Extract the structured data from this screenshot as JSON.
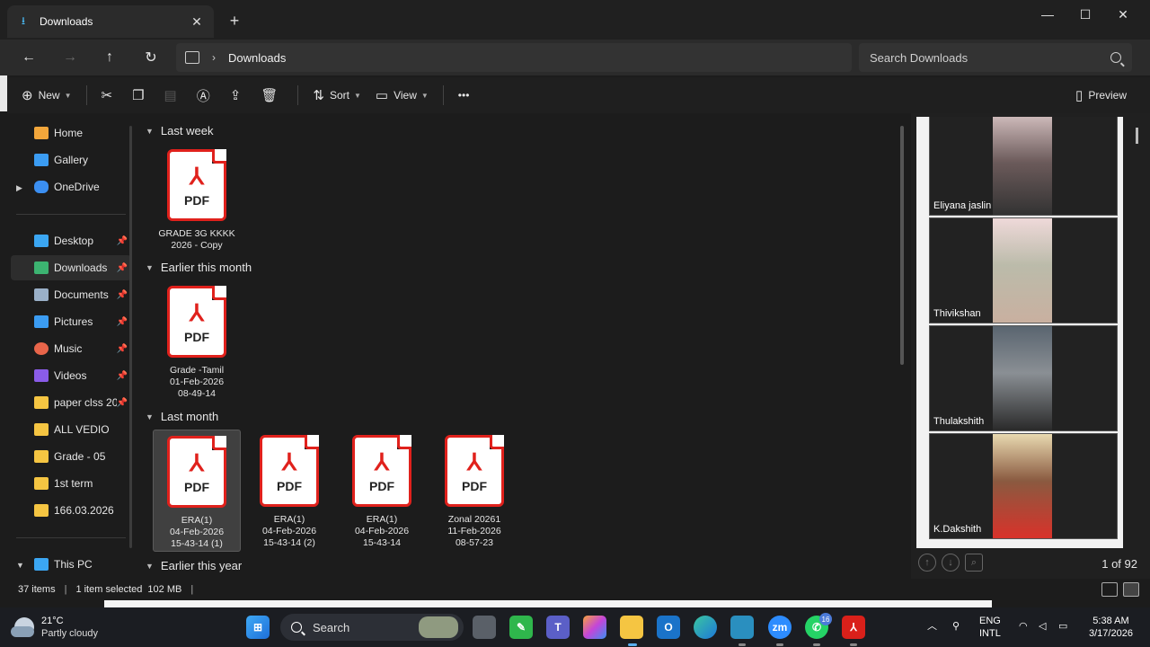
{
  "window": {
    "tab_title": "Downloads",
    "close_tab": "✕",
    "new_tab": "+",
    "minimize": "—",
    "maximize": "☐",
    "close": "✕"
  },
  "address": {
    "crumb": "Downloads",
    "search_placeholder": "Search Downloads"
  },
  "commands": {
    "new_label": "New",
    "sort_label": "Sort",
    "view_label": "View",
    "more": "•••",
    "preview_label": "Preview"
  },
  "sidebar": {
    "items": [
      {
        "label": "Home",
        "icon": "home-icon",
        "color": "#f2a63b"
      },
      {
        "label": "Gallery",
        "icon": "gallery-icon",
        "color": "#3b9cf2"
      },
      {
        "label": "OneDrive",
        "icon": "onedrive-icon",
        "color": "#3b8ff2"
      },
      {
        "label": "Desktop",
        "icon": "desktop-icon",
        "color": "#3ba6f2"
      },
      {
        "label": "Downloads",
        "icon": "downloads-icon",
        "color": "#3cb371"
      },
      {
        "label": "Documents",
        "icon": "documents-icon",
        "color": "#9ab0c8"
      },
      {
        "label": "Pictures",
        "icon": "pictures-icon",
        "color": "#3b9cf2"
      },
      {
        "label": "Music",
        "icon": "music-icon",
        "color": "#e8654a"
      },
      {
        "label": "Videos",
        "icon": "videos-icon",
        "color": "#8a5ce8"
      },
      {
        "label": "paper clss 20",
        "icon": "folder-icon",
        "color": "#f5c542"
      },
      {
        "label": "ALL VEDIO",
        "icon": "folder-icon",
        "color": "#f5c542"
      },
      {
        "label": "Grade - 05",
        "icon": "folder-icon",
        "color": "#f5c542"
      },
      {
        "label": "1st term",
        "icon": "folder-icon",
        "color": "#f5c542"
      },
      {
        "label": "166.03.2026",
        "icon": "folder-icon",
        "color": "#f5c542"
      },
      {
        "label": "This PC",
        "icon": "this-pc-icon",
        "color": "#3ba6f2"
      }
    ]
  },
  "groups": [
    {
      "label": "Last week"
    },
    {
      "label": "Earlier this month"
    },
    {
      "label": "Last month"
    },
    {
      "label": "Earlier this year"
    }
  ],
  "files": [
    {
      "line1": "GRADE 3G KKKK",
      "line2": "2026 - Copy",
      "line3": ""
    },
    {
      "line1": "Grade -Tamil",
      "line2": "01-Feb-2026",
      "line3": "08-49-14"
    },
    {
      "line1": "ERA(1)",
      "line2": "04-Feb-2026",
      "line3": "15-43-14 (1)"
    },
    {
      "line1": "ERA(1)",
      "line2": "04-Feb-2026",
      "line3": "15-43-14 (2)"
    },
    {
      "line1": "ERA(1)",
      "line2": "04-Feb-2026",
      "line3": "15-43-14"
    },
    {
      "line1": "Zonal 20261",
      "line2": "11-Feb-2026",
      "line3": "08-57-23"
    }
  ],
  "pdf_label": "PDF",
  "preview": {
    "participants": [
      "Eliyana jaslin",
      "Thivikshan",
      "Thulakshith",
      "K.Dakshith"
    ],
    "page_count": "1 of 92"
  },
  "status": {
    "items": "37 items",
    "selected": "1 item selected",
    "size": "102 MB"
  },
  "taskbar": {
    "temp": "21°C",
    "weather": "Partly cloudy",
    "search": "Search",
    "whatsapp_badge": "16",
    "lang1": "ENG",
    "lang2": "INTL",
    "time": "5:38 AM",
    "date": "3/17/2026"
  }
}
